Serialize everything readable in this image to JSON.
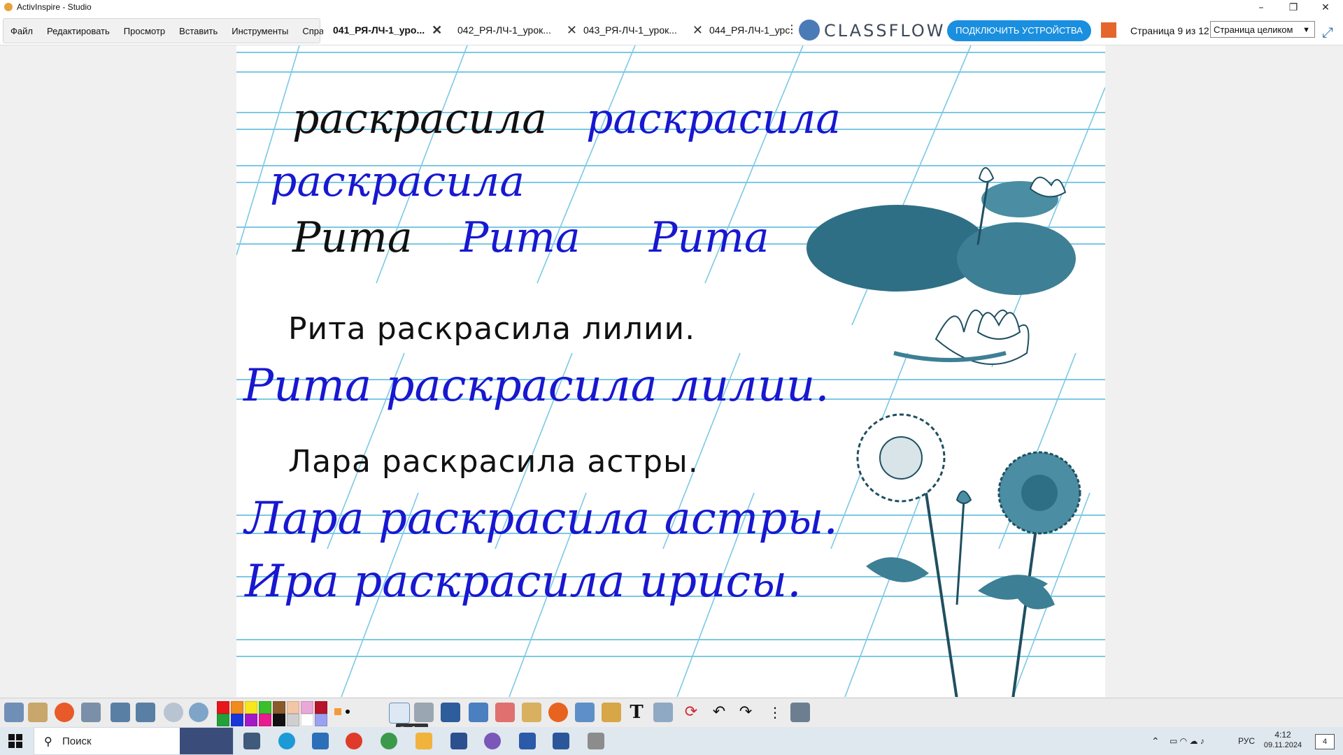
{
  "window": {
    "title": "ActivInspire - Studio",
    "controls": [
      "–",
      "❐",
      "✕"
    ]
  },
  "menu": [
    "Файл",
    "Редактировать",
    "Просмотр",
    "Вставить",
    "Инструменты",
    "Справка"
  ],
  "tabs": [
    {
      "label": "041_РЯ-ЛЧ-1_уро...",
      "active": true
    },
    {
      "label": "042_РЯ-ЛЧ-1_урок...",
      "active": false
    },
    {
      "label": "043_РЯ-ЛЧ-1_урок...",
      "active": false
    },
    {
      "label": "044_РЯ-ЛЧ-1_урс",
      "active": false
    }
  ],
  "tab_close_glyph": "✕",
  "classflow": {
    "brand": "CLASSFLOW",
    "connect_button": "ПОДКЛЮЧИТЬ УСТРОЙСТВА"
  },
  "page_indicator": "Страница 9 из 12",
  "view_mode": "Страница целиком",
  "canvas": {
    "handwriting": [
      {
        "text": "раскрасила",
        "color": "black"
      },
      {
        "text": "раскрасила",
        "color": "blue"
      },
      {
        "text": "раскрасила",
        "color": "blue"
      },
      {
        "text": "Рита",
        "color": "black"
      },
      {
        "text": "Рита",
        "color": "blue"
      },
      {
        "text": "Рита",
        "color": "blue"
      }
    ],
    "sentence1": "Рита раскрасила лилии.",
    "sentence1_hand": "Рита раскрасила лилии.",
    "sentence2": "Лара раскрасила астры.",
    "sentence2_hand": "Лара раскрасила астры.",
    "sentence3_hand": "Ира раскрасила ирисы."
  },
  "palette_colors": [
    "#e8161b",
    "#f28a1c",
    "#f7e81b",
    "#3bbf2a",
    "#8a5a2b",
    "#f2c7a8",
    "#e9a8d7",
    "#b6142a",
    "#23a03a",
    "#1a36d8",
    "#a21ac8",
    "#e81c8e",
    "#111111",
    "#cfcfcf",
    "#ffffff",
    "#9aa2f0"
  ],
  "tooltip": "Выбор",
  "taskbar": {
    "search_placeholder": "Поиск",
    "language": "РУС",
    "time": "4:12",
    "date": "09.11.2024",
    "notifications": "4"
  }
}
